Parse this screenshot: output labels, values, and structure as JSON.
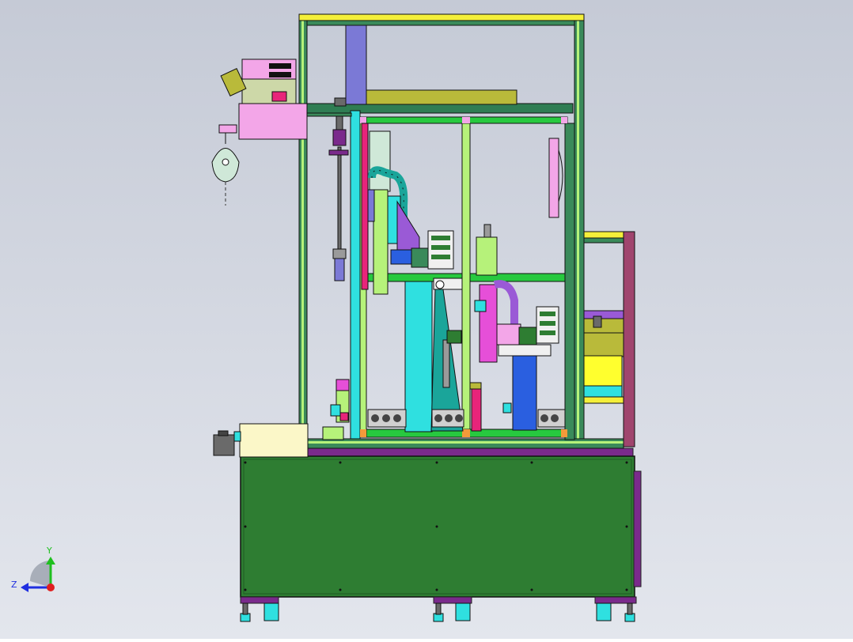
{
  "view": {
    "background_top": "#c5cad6",
    "background_bottom": "#e3e6ed"
  },
  "triad": {
    "y_label": "Y",
    "z_label": "Z",
    "y_color": "#1fbf1f",
    "z_color": "#1f2fe0",
    "x_color": "#e01f1f"
  },
  "colors": {
    "cabinet": "#2e7d32",
    "frame_post": "#3a8a5a",
    "frame_rail": "#2f7d53",
    "top_rail": "#f4ef3a",
    "inner_frame": "#27c93f",
    "magenta": "#e64fd8",
    "pink": "#f3a6e8",
    "purple": "#7a2a8c",
    "cyan": "#2fe0e0",
    "teal": "#1aa59a",
    "olive": "#b9ba3a",
    "lightgreen": "#b6f27a",
    "blue": "#2a5fe0",
    "violet": "#7b79d6",
    "cream": "#fbf7c8",
    "yellow": "#ffff2e",
    "grey": "#6a6a6a"
  }
}
